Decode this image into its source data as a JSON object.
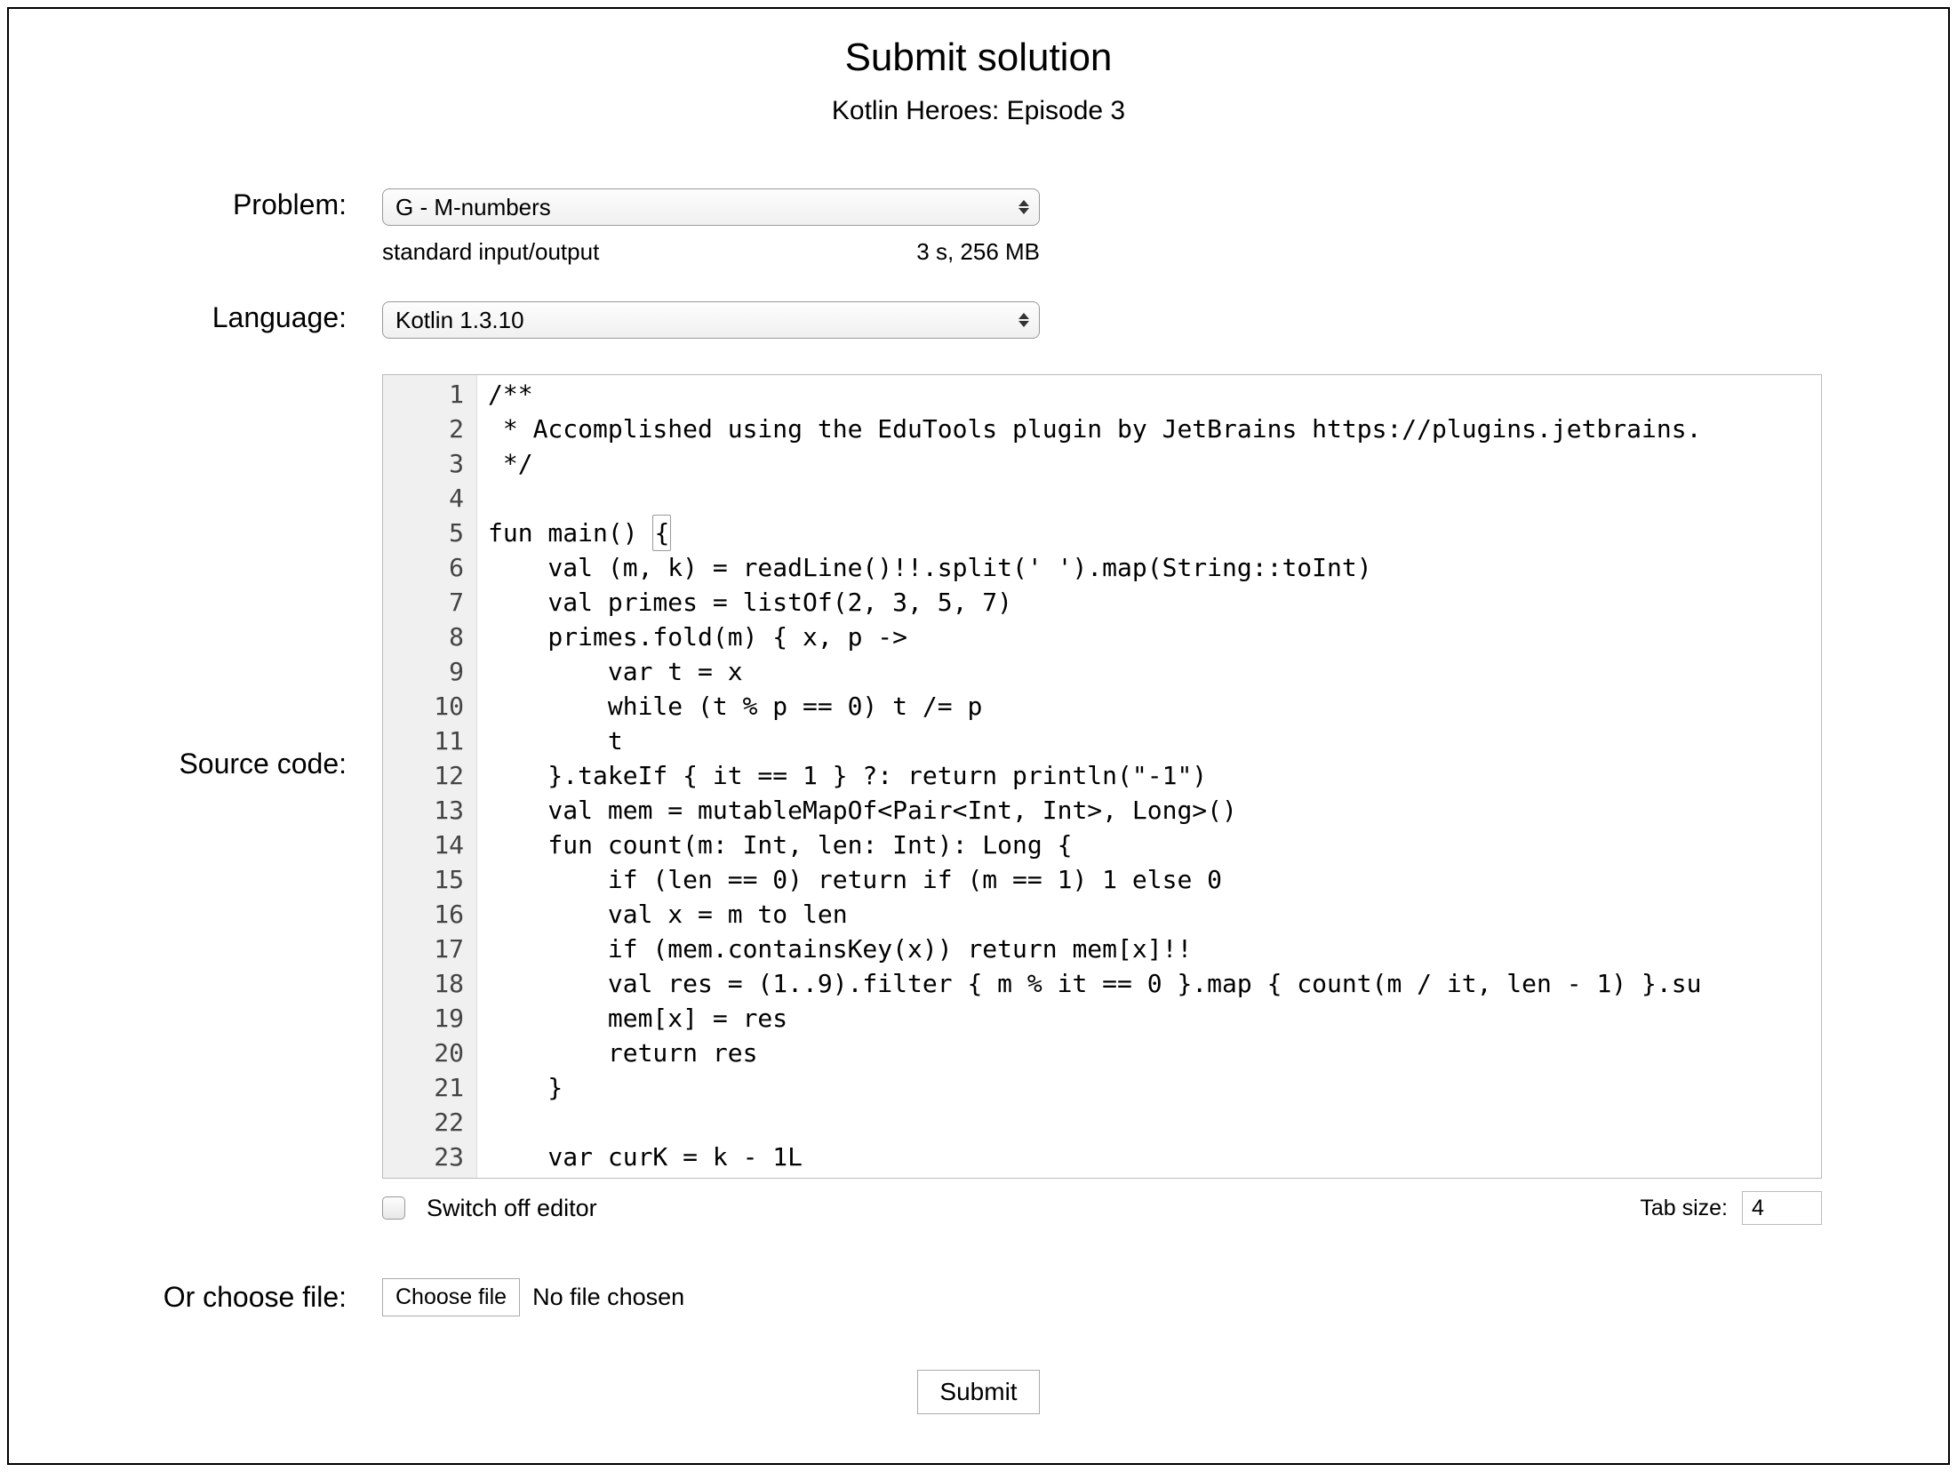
{
  "header": {
    "title": "Submit solution",
    "subtitle": "Kotlin Heroes: Episode 3"
  },
  "labels": {
    "problem": "Problem:",
    "language": "Language:",
    "source_code": "Source code:",
    "or_choose_file": "Or choose file:",
    "switch_off_editor": "Switch off editor",
    "tab_size": "Tab size:",
    "choose_file": "Choose file",
    "no_file_chosen": "No file chosen",
    "submit": "Submit"
  },
  "problem": {
    "selected": "G - M-numbers",
    "io_mode": "standard input/output",
    "limits": "3 s, 256 MB"
  },
  "language": {
    "selected": "Kotlin 1.3.10"
  },
  "editor": {
    "tab_size": "4",
    "switch_off_checked": false,
    "lines": [
      "/**",
      " * Accomplished using the EduTools plugin by JetBrains https://plugins.jetbrains.",
      " */",
      "",
      "fun main() {",
      "    val (m, k) = readLine()!!.split(' ').map(String::toInt)",
      "    val primes = listOf(2, 3, 5, 7)",
      "    primes.fold(m) { x, p ->",
      "        var t = x",
      "        while (t % p == 0) t /= p",
      "        t",
      "    }.takeIf { it == 1 } ?: return println(\"-1\")",
      "    val mem = mutableMapOf<Pair<Int, Int>, Long>()",
      "    fun count(m: Int, len: Int): Long {",
      "        if (len == 0) return if (m == 1) 1 else 0",
      "        val x = m to len",
      "        if (mem.containsKey(x)) return mem[x]!!",
      "        val res = (1..9).filter { m % it == 0 }.map { count(m / it, len - 1) }.su",
      "        mem[x] = res",
      "        return res",
      "    }",
      "",
      "    var curK = k - 1L"
    ]
  }
}
